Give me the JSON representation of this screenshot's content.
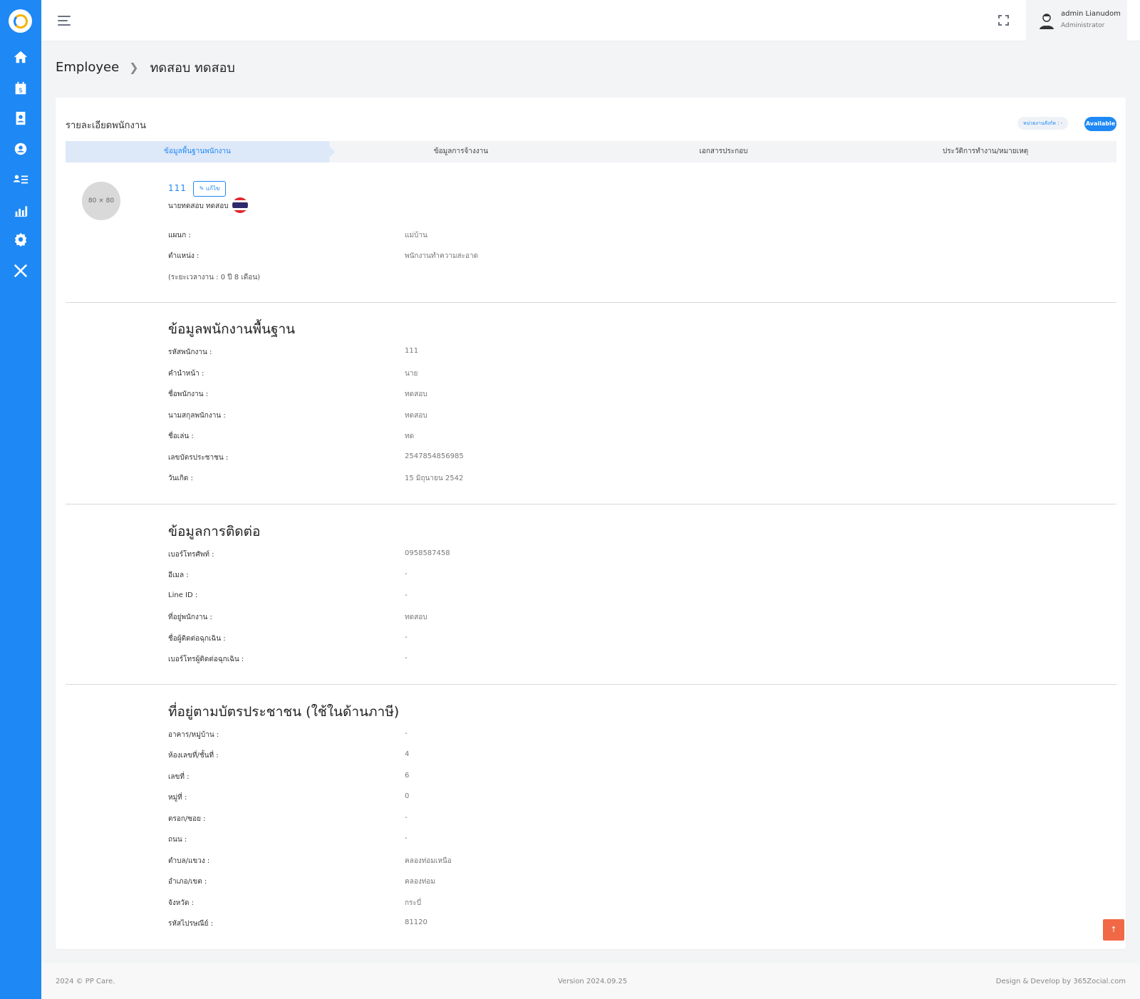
{
  "sidebar": {
    "items": [
      {
        "icon": "home-icon"
      },
      {
        "icon": "calendar-dollar-icon"
      },
      {
        "icon": "contact-book-icon"
      },
      {
        "icon": "employee-gear-icon"
      },
      {
        "icon": "user-list-icon"
      },
      {
        "icon": "chart-icon"
      },
      {
        "icon": "settings-icon"
      },
      {
        "icon": "tools-icon"
      }
    ]
  },
  "header": {
    "user_name": "admin Lianudom",
    "user_role": "Administrator"
  },
  "breadcrumb": {
    "parent": "Employee",
    "current": "ทดสอบ ทดสอบ"
  },
  "card": {
    "title": "รายละเอียดพนักงาน",
    "unit_badge": "หน่วยงานสังกัด : -",
    "status_badge": "Available"
  },
  "tabs": [
    {
      "label": "ข้อมูลพื้นฐานพนักงาน",
      "active": true
    },
    {
      "label": "ข้อมูลการจ้างงาน",
      "active": false
    },
    {
      "label": "เอกสารประกอบ",
      "active": false
    },
    {
      "label": "ประวัติการทำงาน/หมายเหตุ",
      "active": false
    }
  ],
  "profile": {
    "photo_placeholder": "80 × 80",
    "code": "111",
    "edit_label": "✎ แก้ไข",
    "full_name": "นายทดสอบ ทดสอบ",
    "department_label": "แผนก :",
    "department_value": "แม่บ้าน",
    "position_label": "ตำแหน่ง :",
    "position_value": "พนักงานทำความสะอาด",
    "tenure": "(ระยะเวลางาน : 0 ปี 8 เดือน)"
  },
  "basic_info": {
    "title": "ข้อมูลพนักงานพื้นฐาน",
    "rows": [
      {
        "label": "รหัสพนักงาน :",
        "value": "111"
      },
      {
        "label": "คำนำหน้า :",
        "value": "นาย"
      },
      {
        "label": "ชื่อพนักงาน :",
        "value": "ทดสอบ"
      },
      {
        "label": "นามสกุลพนักงาน :",
        "value": "ทดสอบ"
      },
      {
        "label": "ชื่อเล่น :",
        "value": "ทด"
      },
      {
        "label": "เลขบัตรประชาชน :",
        "value": "2547854856985"
      },
      {
        "label": "วันเกิด :",
        "value": "15 มิถุนายน 2542"
      }
    ]
  },
  "contact_info": {
    "title": "ข้อมูลการติดต่อ",
    "rows": [
      {
        "label": "เบอร์โทรศัพท์ :",
        "value": "0958587458"
      },
      {
        "label": "อีเมล :",
        "value": "-"
      },
      {
        "label": "Line ID :",
        "value": "-"
      },
      {
        "label": "ที่อยู่พนักงาน :",
        "value": "ทดสอบ"
      },
      {
        "label": "ชื่อผู้ติดต่อฉุกเฉิน :",
        "value": "-"
      },
      {
        "label": "เบอร์โทรผู้ติดต่อฉุกเฉิน :",
        "value": "-"
      }
    ]
  },
  "address_info": {
    "title": "ที่อยู่ตามบัตรประชาชน (ใช้ในด้านภาษี)",
    "rows": [
      {
        "label": "อาคาร/หมู่บ้าน :",
        "value": "-"
      },
      {
        "label": "ห้องเลขที่/ชั้นที่ :",
        "value": "4"
      },
      {
        "label": "เลขที่ :",
        "value": "6"
      },
      {
        "label": "หมู่ที่ :",
        "value": "0"
      },
      {
        "label": "ตรอก/ซอย :",
        "value": "-"
      },
      {
        "label": "ถนน :",
        "value": "-"
      },
      {
        "label": "ตำบล/แขวง :",
        "value": "คลองท่อมเหนือ"
      },
      {
        "label": "อำเภอ/เขต :",
        "value": "คลองท่อม"
      },
      {
        "label": "จังหวัด :",
        "value": "กระบี่"
      },
      {
        "label": "รหัสไปรษณีย์ :",
        "value": "81120"
      }
    ]
  },
  "scroll_top_icon": "arrow-up-icon",
  "footer": {
    "copyright": "2024 © PP Care.",
    "version": "Version 2024.09.25",
    "credit": "Design & Develop by 365Zocial.com"
  },
  "colors": {
    "primary": "#1e88f5",
    "scroll_top": "#f06846",
    "background": "#f3f4f6"
  }
}
